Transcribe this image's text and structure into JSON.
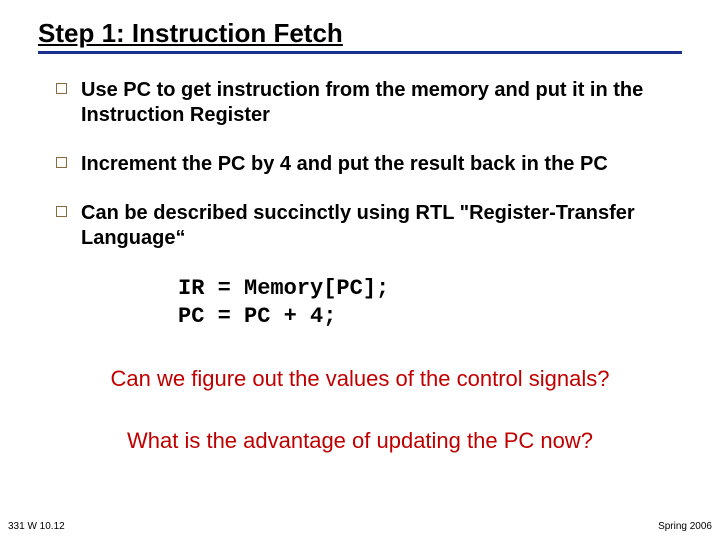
{
  "title": "Step 1:  Instruction Fetch",
  "bullets": [
    "Use PC to get instruction from the memory and put it in the Instruction Register",
    "Increment the PC by 4 and put the result back in the PC",
    "Can be described succinctly using RTL \"Register-Transfer Language“"
  ],
  "code": "IR = Memory[PC];\nPC = PC + 4;",
  "question1": "Can we figure out the values of the control signals?",
  "question2": "What is the advantage of updating the PC now?",
  "footer_left": "331 W 10.12",
  "footer_right": "Spring 2006"
}
